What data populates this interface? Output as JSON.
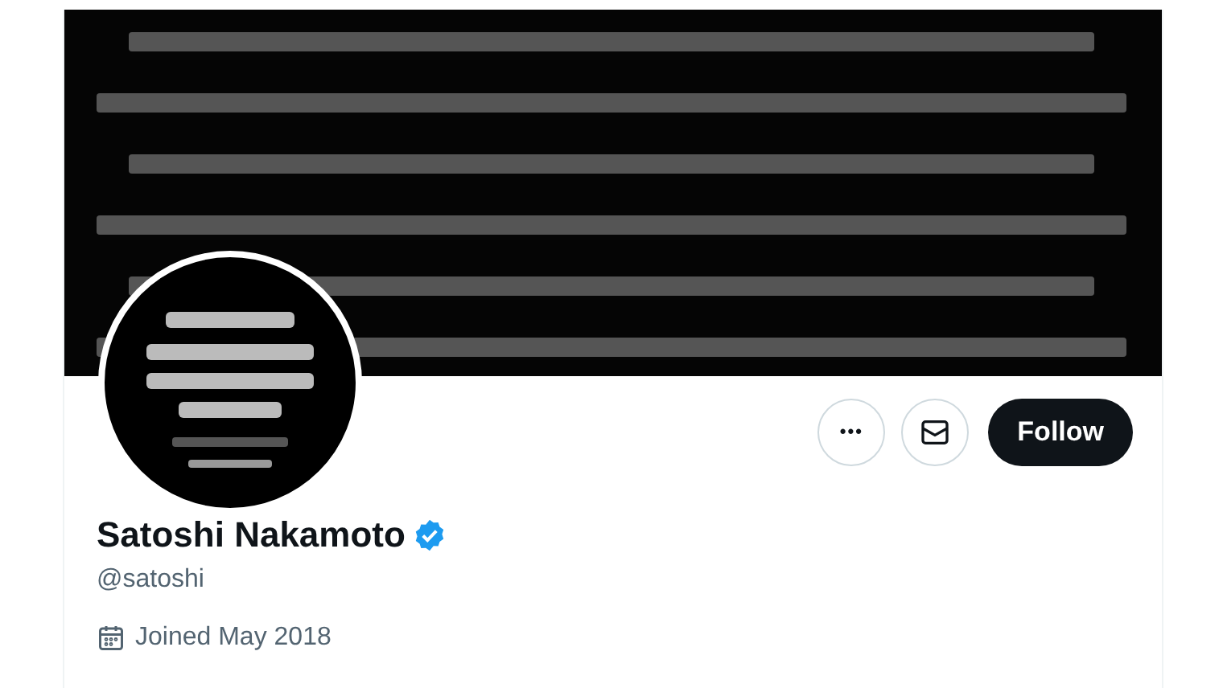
{
  "actions": {
    "more": "•••",
    "follow": "Follow"
  },
  "profile": {
    "name": "Satoshi Nakamoto",
    "verified": true,
    "handle": "@satoshi",
    "joined": "Joined May 2018"
  }
}
